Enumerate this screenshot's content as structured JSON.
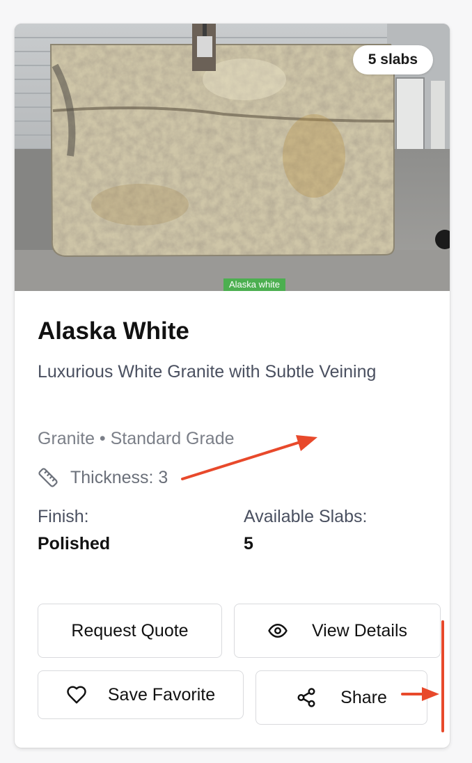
{
  "card": {
    "badge": "5 slabs",
    "photo_label": "Alaska white",
    "title": "Alaska White",
    "subtitle": "Luxurious White Granite with Subtle Veining",
    "meta": "Granite • Standard Grade",
    "thickness": "Thickness: 3",
    "specs": {
      "finish_label": "Finish:",
      "finish_value": "Polished",
      "slabs_label": "Available Slabs:",
      "slabs_value": "5"
    },
    "buttons": {
      "request_quote": "Request Quote",
      "view_details": "View Details",
      "save_favorite": "Save Favorite",
      "share": "Share"
    }
  },
  "icons": [
    "ruler-icon",
    "eye-icon",
    "heart-icon",
    "share-icon"
  ],
  "colors": {
    "badge_bg": "#ffffff",
    "photo_label_bg": "#4caf50",
    "annotation": "#e8492b"
  }
}
